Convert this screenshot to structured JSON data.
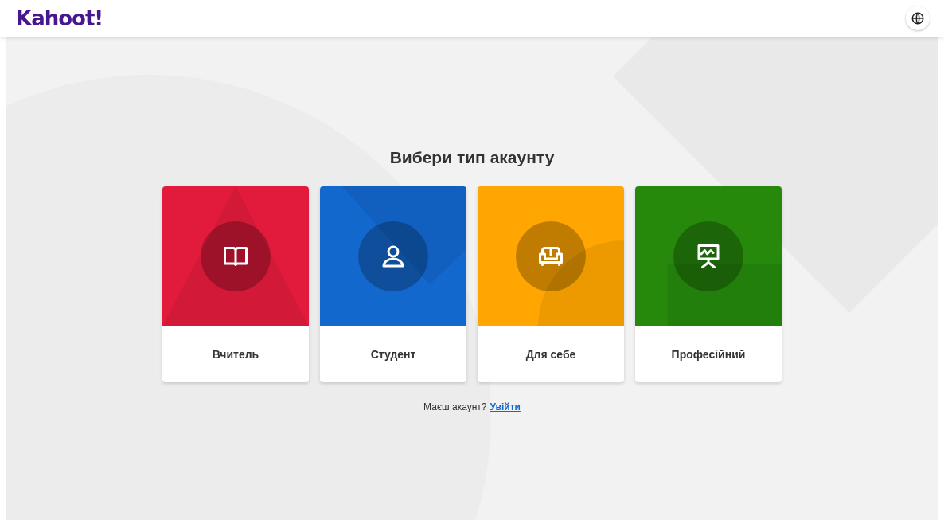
{
  "header": {
    "logo": "Kahoot!"
  },
  "title": "Вибери тип акаунту",
  "cards": [
    {
      "kind": "book",
      "label": "Вчитель",
      "color": "#e21b3c"
    },
    {
      "kind": "person",
      "label": "Студент",
      "color": "#1368ce"
    },
    {
      "kind": "sofa",
      "label": "Для себе",
      "color": "#ffa602"
    },
    {
      "kind": "presentation",
      "label": "Професійний",
      "color": "#26890c"
    }
  ],
  "login": {
    "prompt": "Маєш акаунт?",
    "link": "Увійти"
  }
}
